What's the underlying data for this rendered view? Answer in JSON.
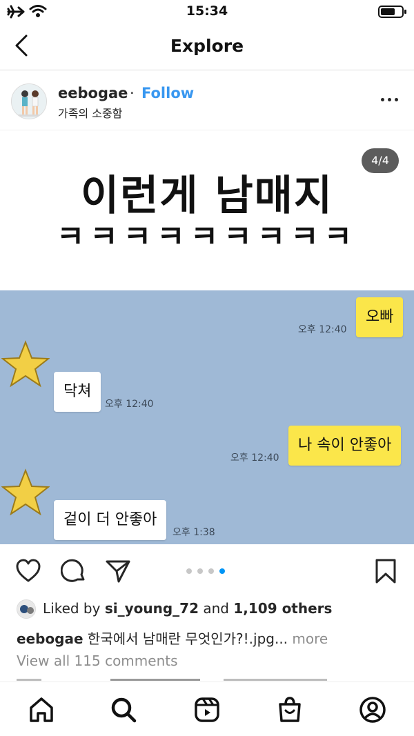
{
  "status_bar": {
    "time": "15:34"
  },
  "nav": {
    "title": "Explore"
  },
  "post": {
    "username": "eebogae",
    "separator": "·",
    "follow_label": "Follow",
    "subtitle": "가족의 소중함",
    "image": {
      "headline": "이런게 남매지",
      "subline": "ㅋㅋㅋㅋㅋㅋㅋㅋㅋ",
      "counter": "4/4",
      "chat": [
        {
          "sender": "me",
          "text": "오빠",
          "time": "오후 12:40"
        },
        {
          "sender": "other",
          "text": "닥쳐",
          "time": "오후 12:40"
        },
        {
          "sender": "me",
          "text": "나 속이 안좋아",
          "time": "오후 12:40"
        },
        {
          "sender": "other",
          "text": "겉이 더 안좋아",
          "time": "오후 1:38"
        }
      ]
    },
    "pager": {
      "count": 4,
      "active": 4
    },
    "likes": {
      "prefix": "Liked by ",
      "user": "si_young_72",
      "middle": " and ",
      "others": "1,109 others"
    },
    "caption": {
      "user": "eebogae",
      "text": " 한국에서 남매란 무엇인가?!.jpg...",
      "more": " more"
    },
    "comments_link": "View all 115 comments"
  },
  "icons": {
    "status": [
      "airplane-icon",
      "wifi-icon",
      "battery-icon"
    ],
    "nav": [
      "back-chevron-icon"
    ],
    "post_header": [
      "more-options-icon"
    ],
    "actions": [
      "heart-icon",
      "comment-icon",
      "share-icon",
      "bookmark-icon"
    ],
    "tabs": [
      "home-icon",
      "search-icon",
      "reels-icon",
      "shop-icon",
      "profile-icon"
    ]
  },
  "colors": {
    "accent": "#3897f0",
    "pager_active": "#0095f6",
    "chat_background": "#9fb9d6",
    "my_bubble": "#fbe64a",
    "other_bubble": "#ffffff"
  }
}
